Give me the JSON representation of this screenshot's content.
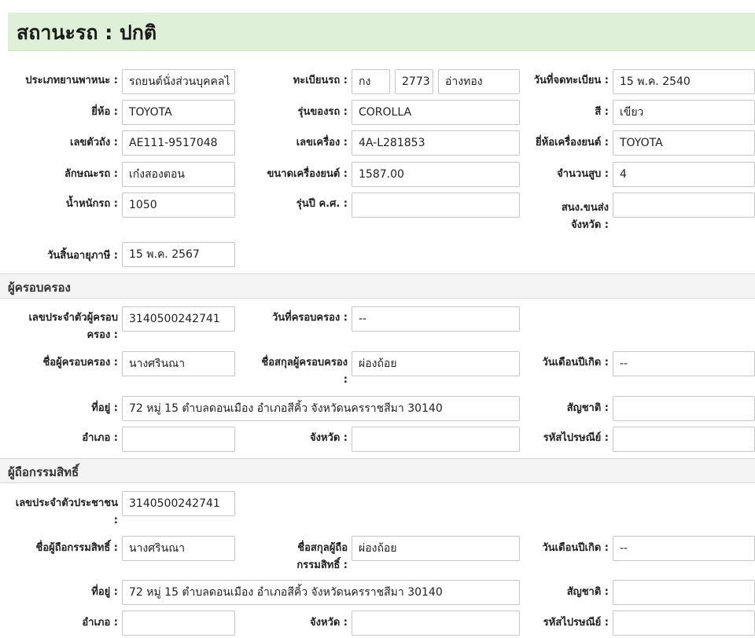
{
  "status": {
    "text": "สถานะรถ :  ปกติ"
  },
  "vehicle": {
    "type_label": "ประเภทยานพาหนะ :",
    "type_value": "รถยนต์นั่งส่วนบุคคลไ",
    "plate_label": "ทะเบียนรถ :",
    "plate_prefix": "กง",
    "plate_number": "2773",
    "plate_province": "อ่างทอง",
    "reg_date_label": "วันที่จดทะเบียน :",
    "reg_date_value": "15 พ.ค. 2540",
    "brand_label": "ยี่ห้อ :",
    "brand_value": "TOYOTA",
    "model_label": "รุ่นของรถ :",
    "model_value": "COROLLA",
    "color_label": "สี :",
    "color_value": "เขียว",
    "chassis_label": "เลขตัวถัง :",
    "chassis_value": "AE111-9517048",
    "engine_no_label": "เลขเครื่อง :",
    "engine_no_value": "4A-L281853",
    "engine_brand_label": "ยี่ห้อเครื่องยนต์ :",
    "engine_brand_value": "TOYOTA",
    "body_label": "ลักษณะรถ :",
    "body_value": "เก๋งสองตอน",
    "engine_size_label": "ขนาดเครื่องยนต์ :",
    "engine_size_value": "1587.00",
    "cylinders_label": "จำนวนสูบ :",
    "cylinders_value": "4",
    "weight_label": "น้ำหนักรถ :",
    "weight_value": "1050",
    "model_year_label": "รุ่นปี ค.ศ. :",
    "model_year_value": "",
    "office_label_1": "สนง.ขนส่ง",
    "office_label_2": "จังหวัด :",
    "office_value": "",
    "tax_expiry_label": "วันสิ้นอายุภาษี :",
    "tax_expiry_value": "15 พ.ค. 2567"
  },
  "possessor": {
    "section_title": "ผู้ครอบครอง",
    "id_label_1": "เลขประจำตัวผู้ครอบ",
    "id_label_2": "ครอง :",
    "id_value": "3140500242741",
    "since_label": "วันที่ครอบครอง :",
    "since_value": "--",
    "name_label": "ชื่อผู้ครอบครอง :",
    "name_value": "นางศรินณา",
    "surname_label_1": "ชื่อสกุลผู้ครอบครอง",
    "surname_label_2": ":",
    "surname_value": "ผ่องถ้อย",
    "dob_label": "วันเดือนปีเกิด :",
    "dob_value": "--",
    "address_label": "ที่อยู่ :",
    "address_value": "72    หมู่ 15    ตำบลดอนเมือง อำเภอสีคิ้ว จังหวัดนครราชสีมา 30140",
    "nationality_label": "สัญชาติ :",
    "nationality_value": "",
    "district_label": "อำเภอ :",
    "district_value": "",
    "province_label": "จังหวัด :",
    "province_value": "",
    "postcode_label": "รหัสไปรษณีย์ :",
    "postcode_value": ""
  },
  "owner": {
    "section_title": "ผู้ถือกรรมสิทธิ์",
    "id_label_1": "เลขประจำตัวประชาชน",
    "id_label_2": ":",
    "id_value": "3140500242741",
    "name_label": "ชื่อผู้ถือกรรมสิทธิ์ :",
    "name_value": "นางศรินณา",
    "surname_label_1": "ชื่อสกุลผู้ถือ",
    "surname_label_2": "กรรมสิทธิ์ :",
    "surname_value": "ผ่องถ้อย",
    "dob_label": "วันเดือนปีเกิด :",
    "dob_value": "--",
    "address_label": "ที่อยู่ :",
    "address_value": "72    หมู่ 15    ตำบลดอนเมือง อำเภอสีคิ้ว จังหวัดนครราชสีมา 30140",
    "nationality_label": "สัญชาติ :",
    "nationality_value": "",
    "district_label": "อำเภอ :",
    "district_value": "",
    "province_label": "จังหวัด :",
    "province_value": "",
    "postcode_label": "รหัสไปรษณีย์ :",
    "postcode_value": ""
  }
}
